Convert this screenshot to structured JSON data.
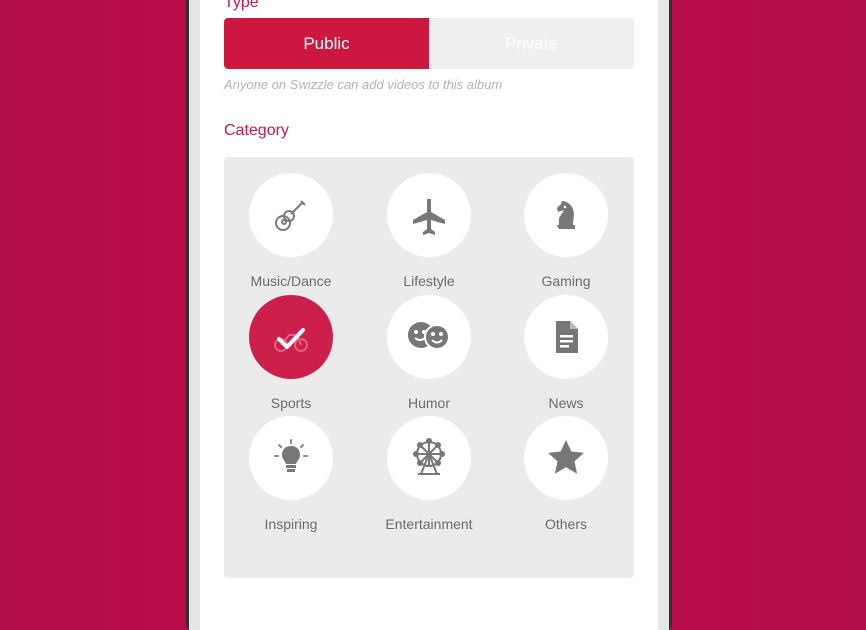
{
  "form": {
    "type_label": "Type",
    "type_options": [
      "Public",
      "Private"
    ],
    "type_selected": "Public",
    "type_helper": "Anyone on Swizzle can add videos to this album",
    "category_label": "Category"
  },
  "categories": [
    {
      "label": "Music/Dance",
      "icon": "guitar-icon",
      "selected": false
    },
    {
      "label": "Lifestyle",
      "icon": "airplane-icon",
      "selected": false
    },
    {
      "label": "Gaming",
      "icon": "chess-knight-icon",
      "selected": false
    },
    {
      "label": "Sports",
      "icon": "check-icon",
      "selected": true
    },
    {
      "label": "Humor",
      "icon": "smiley-faces-icon",
      "selected": false
    },
    {
      "label": "News",
      "icon": "document-icon",
      "selected": false
    },
    {
      "label": "Inspiring",
      "icon": "lightbulb-icon",
      "selected": false
    },
    {
      "label": "Entertainment",
      "icon": "ferris-wheel-icon",
      "selected": false
    },
    {
      "label": "Others",
      "icon": "star-icon",
      "selected": false
    }
  ],
  "colors": {
    "accent": "#cc1840",
    "background": "#c40a4e",
    "icon_gray": "#777777"
  }
}
